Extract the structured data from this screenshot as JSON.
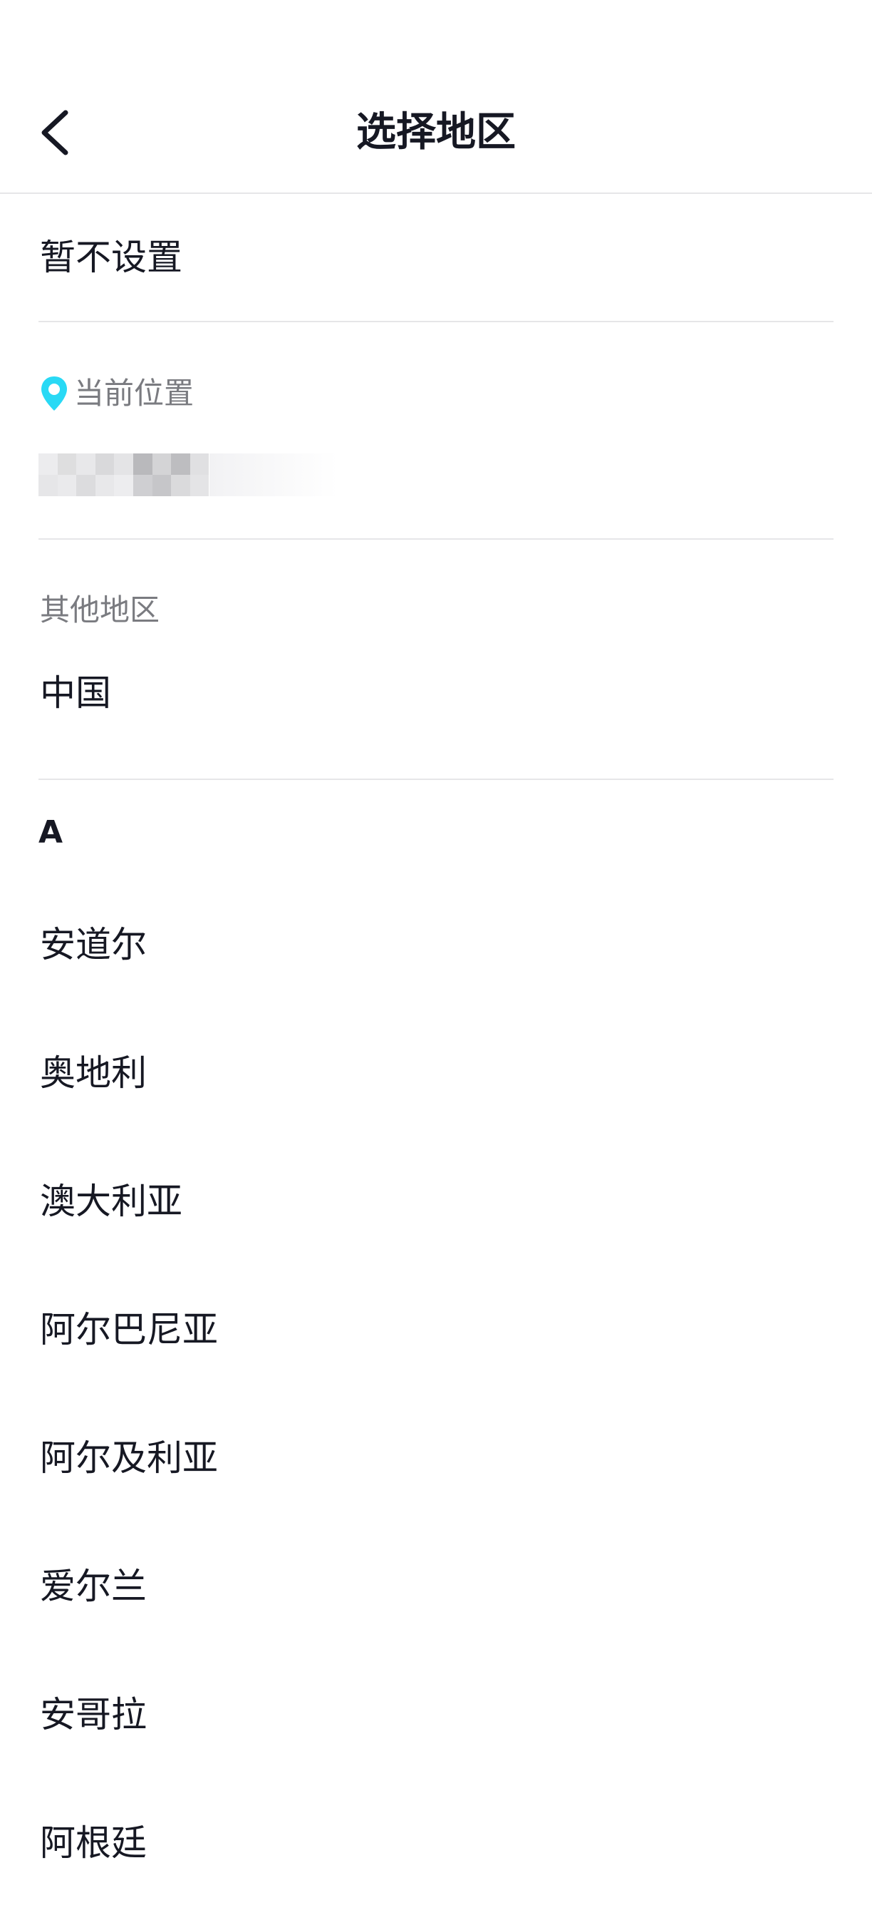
{
  "header": {
    "title": "选择地区",
    "back_icon": "chevron-left-icon"
  },
  "not_set": {
    "label": "暂不设置"
  },
  "current_location": {
    "label": "当前位置",
    "icon": "location-pin-icon",
    "icon_color": "#29d9f5",
    "value": ""
  },
  "other_regions": {
    "label": "其他地区",
    "items": [
      "中国"
    ]
  },
  "index": {
    "letter": "A",
    "countries": [
      "安道尔",
      "奥地利",
      "澳大利亚",
      "阿尔巴尼亚",
      "阿尔及利亚",
      "爱尔兰",
      "安哥拉",
      "阿根廷"
    ]
  }
}
